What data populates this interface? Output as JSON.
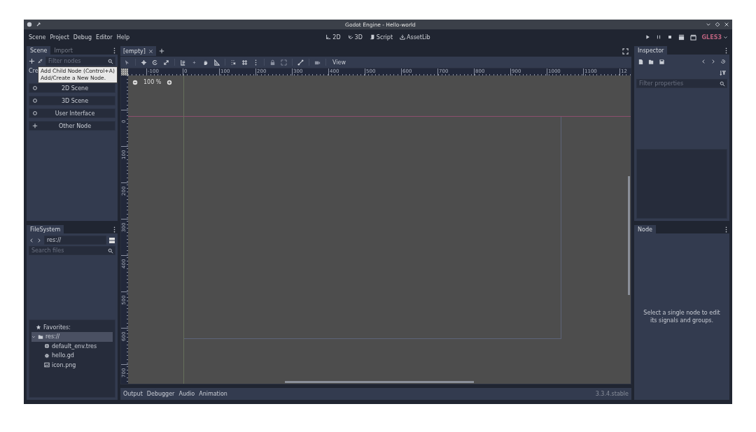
{
  "window": {
    "title": "Godot Engine - Hello-world"
  },
  "menu": [
    "Scene",
    "Project",
    "Debug",
    "Editor",
    "Help"
  ],
  "workspaces": [
    {
      "kind": "flat",
      "label": "2D"
    },
    {
      "kind": "space",
      "label": "3D"
    },
    {
      "kind": "script",
      "label": "Script"
    },
    {
      "kind": "assetlib",
      "label": "AssetLib"
    }
  ],
  "renderer": "GLES3",
  "scene_dock": {
    "tabs": [
      {
        "label": "Scene",
        "selected": true
      },
      {
        "label": "Import",
        "selected": false
      }
    ],
    "filter_placeholder": "Filter nodes",
    "create_label": "Cre",
    "create_buttons": [
      {
        "kind": "circle",
        "label": "2D Scene"
      },
      {
        "kind": "circle",
        "label": "3D Scene"
      },
      {
        "kind": "circle",
        "label": "User Interface"
      },
      {
        "kind": "plus",
        "label": "Other Node"
      }
    ],
    "tooltip": [
      "Add Child Node (Control+A)",
      "Add/Create a New Node."
    ]
  },
  "filesystem": {
    "tabs": [
      {
        "label": "FileSystem",
        "selected": true
      }
    ],
    "path": "res://",
    "search_placeholder": "Search files",
    "tree": [
      {
        "kind": "favorites",
        "label": "Favorites:",
        "selected": false
      },
      {
        "kind": "folder",
        "label": "res://",
        "selected": true,
        "expanded": true,
        "children": [
          {
            "kind": "resource",
            "label": "default_env.tres",
            "selected": false
          },
          {
            "kind": "script",
            "label": "hello.gd",
            "selected": false
          },
          {
            "kind": "image",
            "label": "icon.png",
            "selected": false
          }
        ]
      }
    ]
  },
  "scene_tabs": [
    {
      "label": "[empty]",
      "selected": true
    }
  ],
  "toolbar": {
    "view_menu": "View"
  },
  "viewport": {
    "zoom": "100 %",
    "x_ruler": [
      "-100",
      "0",
      "100",
      "200",
      "300",
      "400",
      "500",
      "600",
      "700",
      "800",
      "900",
      "1000",
      "1100",
      "12"
    ],
    "y_ruler": [
      "0",
      "100",
      "200",
      "300",
      "400",
      "500",
      "600",
      "700"
    ]
  },
  "bottom_tabs": [
    "Output",
    "Debugger",
    "Audio",
    "Animation"
  ],
  "version": "3.3.4.stable",
  "inspector": {
    "tabs": [
      {
        "label": "Inspector",
        "selected": true
      }
    ],
    "filter_placeholder": "Filter properties"
  },
  "node_dock": {
    "tabs": [
      {
        "label": "Node",
        "selected": true
      }
    ],
    "message": "Select a single node to edit its signals and groups."
  }
}
